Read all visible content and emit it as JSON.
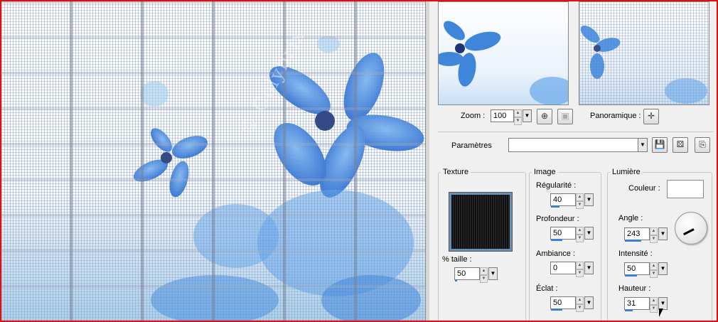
{
  "preview": {
    "watermark": "© Colybrix"
  },
  "nav": {
    "zoom_label": "Zoom :",
    "zoom_value": "100",
    "pan_label": "Panoramique :"
  },
  "presets": {
    "label": "Paramètres",
    "value": ""
  },
  "texture": {
    "title": "Texture",
    "size_label": "% taille :",
    "size_value": "50"
  },
  "image": {
    "title": "Image",
    "fields": [
      {
        "label": "Régularité :",
        "value": "40",
        "fill": 0.4
      },
      {
        "label": "Profondeur :",
        "value": "50",
        "fill": 0.5
      },
      {
        "label": "Ambiance :",
        "value": "0",
        "fill": 0.0
      },
      {
        "label": "Éclat :",
        "value": "50",
        "fill": 0.5
      }
    ]
  },
  "light": {
    "title": "Lumière",
    "color_label": "Couleur :",
    "color_value": "#ffffff",
    "angle_label": "Angle :",
    "angle_value": "243",
    "intensity_label": "Intensité :",
    "intensity_value": "50",
    "height_label": "Hauteur :",
    "height_value": "31"
  },
  "icons": [
    "zoom-fit-icon",
    "zoom-actual-icon",
    "pan-icon",
    "save-preset-icon",
    "random-preset-icon",
    "delete-preset-icon",
    "chevron-down-icon",
    "spin-up-icon",
    "spin-down-icon"
  ],
  "colors": {
    "accent": "#3a7fd8",
    "frame": "#e01010",
    "flower": "#4a8fe0"
  }
}
